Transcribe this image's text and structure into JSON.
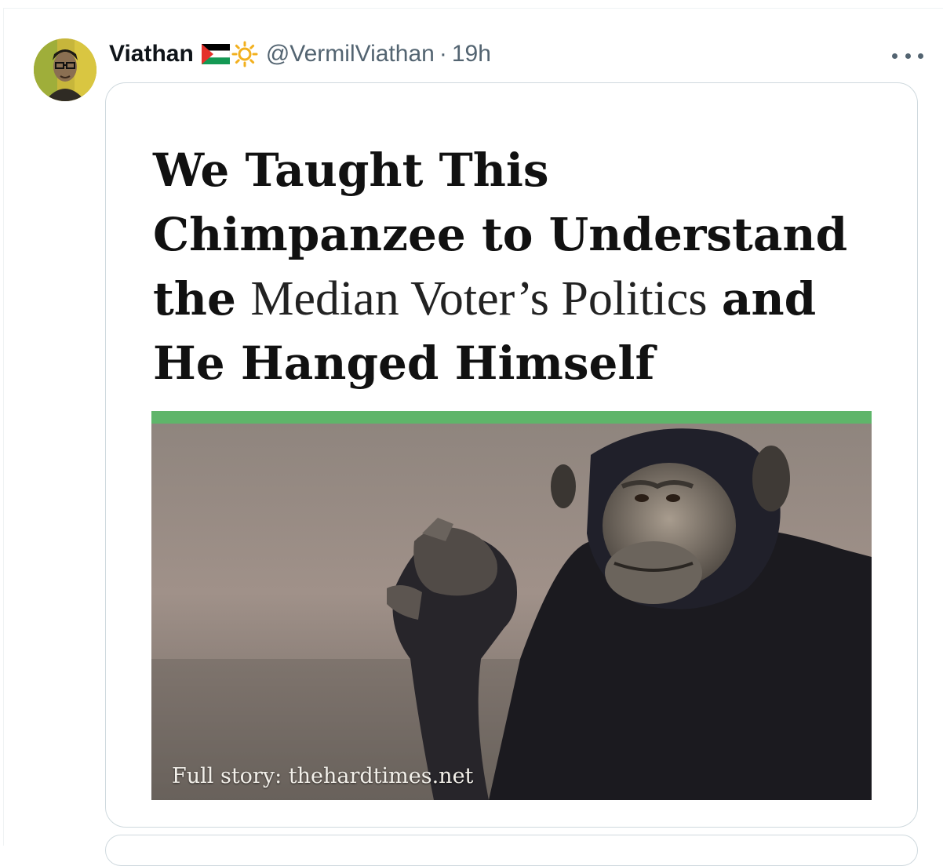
{
  "tweet": {
    "display_name": "Viathan",
    "handle": "@VermilViathan",
    "separator": "·",
    "time": "19h"
  },
  "card": {
    "headline_parts": [
      "We Taught This Chimpanzee to Understand the",
      "Median Voter’s Politics",
      "and He Hanged Himself"
    ],
    "photo_caption": "Full story: thehardtimes.net"
  },
  "icons": {
    "more": "more-icon",
    "flag": "palestine-flag-icon",
    "sun": "sun-icon"
  },
  "colors": {
    "green_bar": "#5fb56a",
    "text_secondary": "#536471",
    "border": "#cfd9de"
  }
}
